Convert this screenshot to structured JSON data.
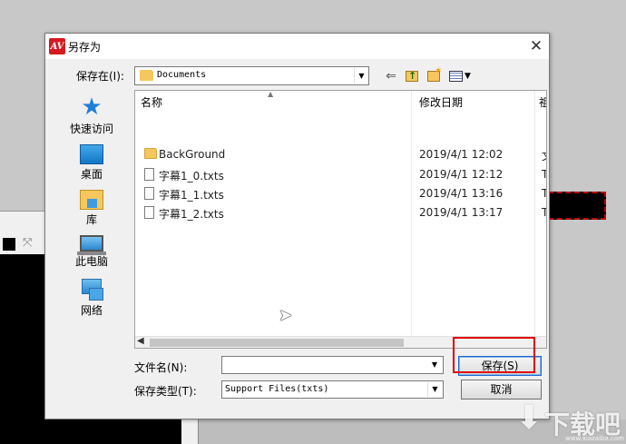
{
  "dialog": {
    "title": "另存为",
    "app_icon_text": "AV",
    "close": "✕"
  },
  "toolbar": {
    "save_in_label": "保存在(I):",
    "save_in_value": "Documents",
    "back_icon": "back-arrow-icon",
    "up_icon": "up-folder-icon",
    "newfolder_icon": "new-folder-icon",
    "view_icon": "view-menu-icon"
  },
  "places": [
    {
      "label": "快速访问",
      "icon": "star-icon"
    },
    {
      "label": "桌面",
      "icon": "desktop-icon"
    },
    {
      "label": "库",
      "icon": "library-icon"
    },
    {
      "label": "此电脑",
      "icon": "computer-icon"
    },
    {
      "label": "网络",
      "icon": "network-icon"
    }
  ],
  "filelist": {
    "columns": {
      "name": "名称",
      "date": "修改日期",
      "extra": "祖"
    },
    "rows": [
      {
        "name": "BackGround",
        "type": "folder",
        "date": "2019/4/1 12:02",
        "extra": "文"
      },
      {
        "name": "字幕1_0.txts",
        "type": "file",
        "date": "2019/4/1 12:12",
        "extra": "T"
      },
      {
        "name": "字幕1_1.txts",
        "type": "file",
        "date": "2019/4/1 13:16",
        "extra": "T"
      },
      {
        "name": "字幕1_2.txts",
        "type": "file",
        "date": "2019/4/1 13:17",
        "extra": "T"
      }
    ]
  },
  "footer": {
    "filename_label": "文件名(N):",
    "filename_value": "",
    "filetype_label": "保存类型(T):",
    "filetype_value": "Support Files(txts)",
    "save_label": "保存(S)",
    "cancel_label": "取消"
  },
  "watermark": {
    "text": "下载吧",
    "url": "www.xiazaiba.com"
  },
  "colors": {
    "highlight": "#e00000",
    "folder": "#f5c75c",
    "accent": "#1c6ad1"
  }
}
